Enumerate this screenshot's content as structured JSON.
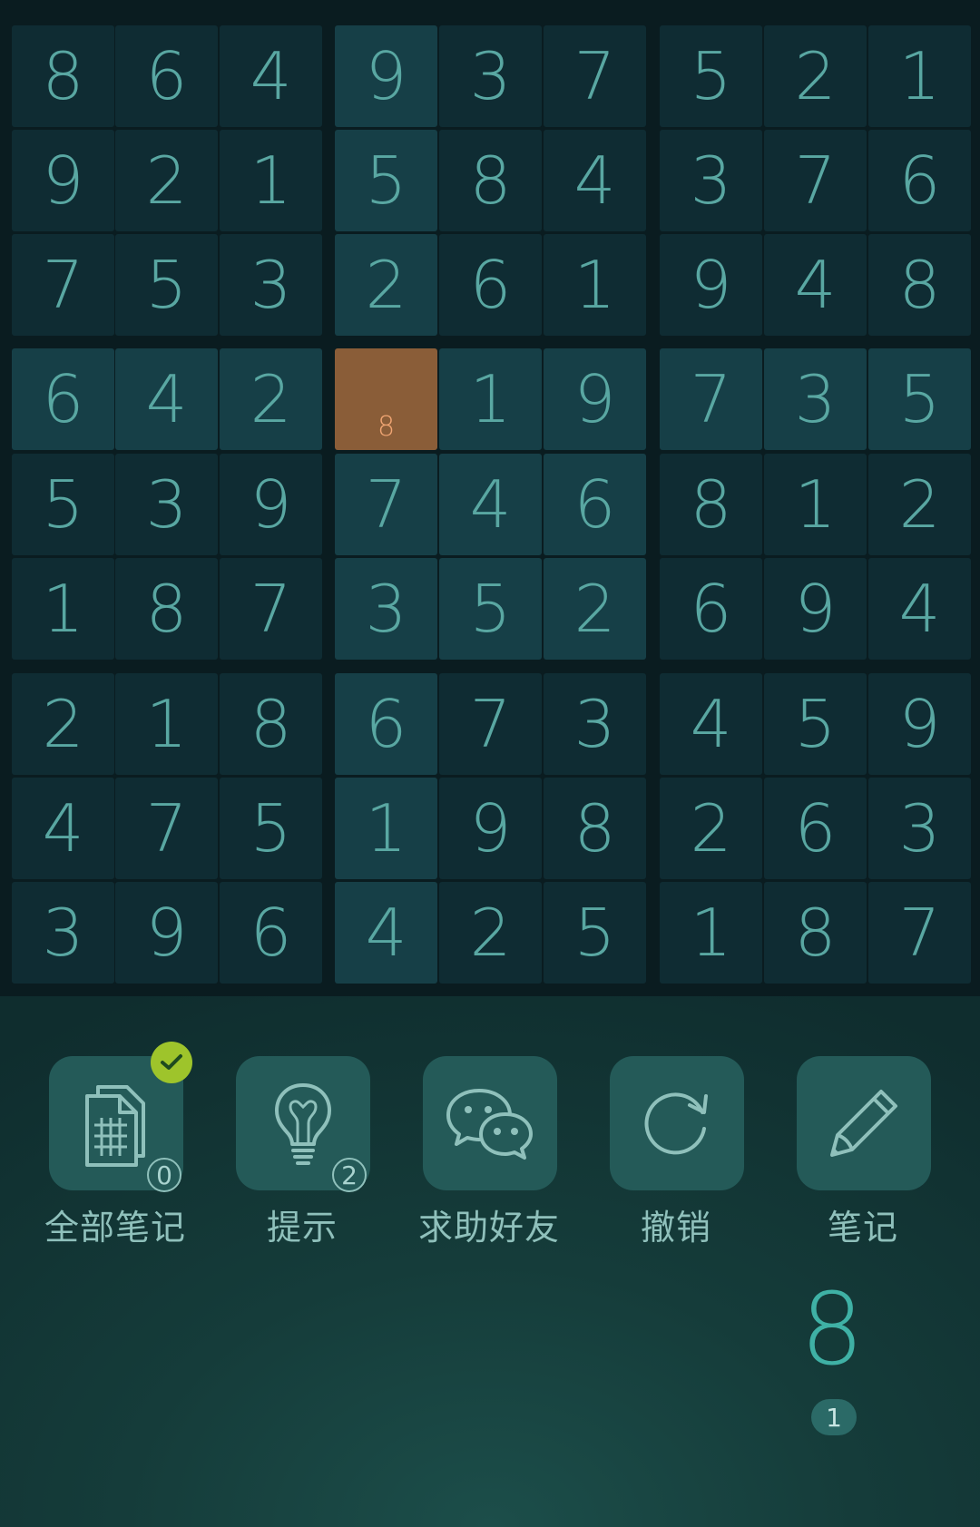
{
  "board": {
    "grid": [
      [
        "8",
        "6",
        "4",
        "9",
        "3",
        "7",
        "5",
        "2",
        "1"
      ],
      [
        "9",
        "2",
        "1",
        "5",
        "8",
        "4",
        "3",
        "7",
        "6"
      ],
      [
        "7",
        "5",
        "3",
        "2",
        "6",
        "1",
        "9",
        "4",
        "8"
      ],
      [
        "6",
        "4",
        "2",
        "",
        "1",
        "9",
        "7",
        "3",
        "5"
      ],
      [
        "5",
        "3",
        "9",
        "7",
        "4",
        "6",
        "8",
        "1",
        "2"
      ],
      [
        "1",
        "8",
        "7",
        "3",
        "5",
        "2",
        "6",
        "9",
        "4"
      ],
      [
        "2",
        "1",
        "8",
        "6",
        "7",
        "3",
        "4",
        "5",
        "9"
      ],
      [
        "4",
        "7",
        "5",
        "1",
        "9",
        "8",
        "2",
        "6",
        "3"
      ],
      [
        "3",
        "9",
        "6",
        "4",
        "2",
        "5",
        "1",
        "8",
        "7"
      ]
    ],
    "selected": {
      "row": 3,
      "col": 3
    },
    "selected_note": "8"
  },
  "toolbar": {
    "all_notes": {
      "label": "全部笔记",
      "count": "0",
      "checked": true,
      "icon": "notes-grid-icon"
    },
    "hint": {
      "label": "提示",
      "count": "2",
      "icon": "lightbulb-icon"
    },
    "ask_friend": {
      "label": "求助好友",
      "icon": "wechat-icon"
    },
    "undo": {
      "label": "撤销",
      "icon": "undo-icon"
    },
    "note": {
      "label": "笔记",
      "icon": "pencil-icon"
    }
  },
  "number_pad": {
    "digit": "8",
    "remaining": "1"
  },
  "colors": {
    "cell": "#0f2c33",
    "cell_related": "#163f47",
    "cell_selected": "#8a5d38",
    "digit": "#59a7a2",
    "accent": "#3fb1a5",
    "check": "#9ec42b"
  }
}
